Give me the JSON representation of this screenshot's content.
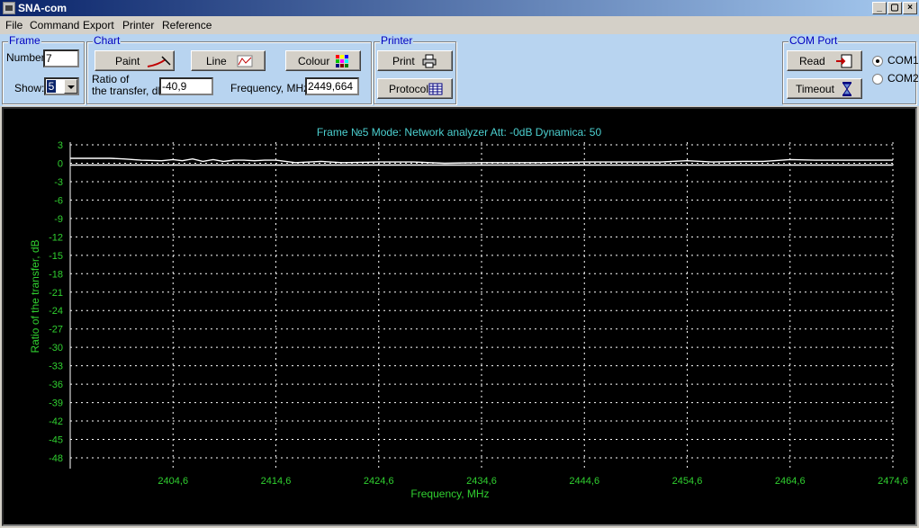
{
  "window": {
    "title": "SNA-com",
    "min": "_",
    "max": "▢",
    "close": "×"
  },
  "menu": [
    "File",
    "Command",
    "Export",
    "Printer",
    "Reference"
  ],
  "frame_group": {
    "legend": "Frame",
    "number_label": "Number:",
    "number_value": "7",
    "show_label": "Show:",
    "show_value": "5"
  },
  "chart_group": {
    "legend": "Chart",
    "paint": "Paint",
    "line": "Line",
    "colour": "Colour",
    "ratio_label_1": "Ratio of",
    "ratio_label_2": "the transfer, dB:",
    "ratio_value": "-40,9",
    "freq_label": "Frequency, MHz:",
    "freq_value": "2449,664"
  },
  "printer_group": {
    "legend": "Printer",
    "print": "Print",
    "protocol": "Protocol"
  },
  "com_group": {
    "legend": "COM Port",
    "read": "Read",
    "timeout": "Timeout",
    "com1": "COM1",
    "com2": "COM2",
    "selected": "COM1"
  },
  "colors": {
    "plot_bg": "#000000",
    "text": "#4cd0d0",
    "axis_text": "#30d030",
    "grid": "#ffffff",
    "trace": "#ffffff"
  },
  "chart_data": {
    "type": "line",
    "title": "Frame №5    Mode: Network analyzer    Att: -0dB    Dynamica: 50",
    "xlabel": "Frequency, MHz",
    "ylabel": "Ratio of the transfer, dB",
    "xlim": [
      2394.6,
      2474.6
    ],
    "ylim": [
      -50,
      3
    ],
    "x_ticks": [
      "2404,6",
      "2414,6",
      "2424,6",
      "2434,6",
      "2444,6",
      "2454,6",
      "2464,6",
      "2474,6"
    ],
    "y_ticks": [
      "3",
      "0",
      "-3",
      "-6",
      "-9",
      "-12",
      "-15",
      "-18",
      "-21",
      "-24",
      "-27",
      "-30",
      "-33",
      "-36",
      "-39",
      "-42",
      "-45",
      "-48"
    ],
    "grid": true,
    "series": [
      {
        "x": [
          2394.6,
          2398.5,
          2399.8,
          2401.5,
          2403.5,
          2404.6,
          2405.5,
          2406.5,
          2407.5,
          2408.5,
          2409.5,
          2410.5,
          2411.5,
          2412.5,
          2413.5,
          2414.6,
          2416.5,
          2419,
          2421,
          2424.6,
          2428,
          2431,
          2434.6,
          2437,
          2440,
          2444.6,
          2448,
          2452,
          2454.6,
          2457,
          2460,
          2462,
          2463,
          2464.6,
          2467,
          2470,
          2474.6
        ],
        "y": [
          0.8,
          0.8,
          0.7,
          0.5,
          0.4,
          0.6,
          0.4,
          0.7,
          0.3,
          0.6,
          0.3,
          0.5,
          0.5,
          0.4,
          0.5,
          0.5,
          0.1,
          0.3,
          0.1,
          0.2,
          0.2,
          0.0,
          0.1,
          0.1,
          0.1,
          0.2,
          0.2,
          0.2,
          0.4,
          0.2,
          0.3,
          0.3,
          0.4,
          0.6,
          0.5,
          0.5,
          0.5
        ]
      },
      {
        "x": [
          2394.6,
          2474.6
        ],
        "y": [
          -0.3,
          -0.3
        ]
      }
    ]
  }
}
